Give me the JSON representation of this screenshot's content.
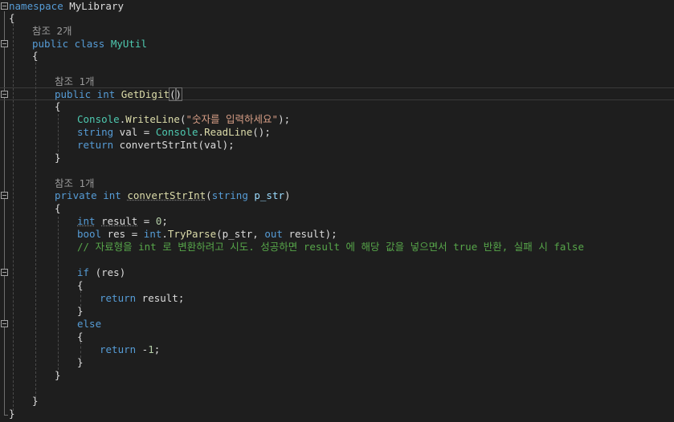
{
  "editor": {
    "line1": {
      "kw": "namespace",
      "name": " MyLibrary"
    },
    "line2": {
      "brace": "{"
    },
    "line3": {
      "lens": "참조 2개"
    },
    "line4": {
      "kw1": "public",
      "kw2": " class ",
      "name": "MyUtil"
    },
    "line5": {
      "brace": "{"
    },
    "line6": {
      "lens": "참조 1개"
    },
    "line7": {
      "kw1": "public",
      "kw2": " int ",
      "name": "GetDigit",
      "open": "(",
      "close": ")"
    },
    "line8": {
      "brace": "{"
    },
    "line9": {
      "type": "Console",
      "dot": ".",
      "method": "WriteLine",
      "open": "(",
      "str": "\"숫자를 입력하세요\"",
      "end": ");"
    },
    "line10": {
      "kw": "string",
      "var": " val = ",
      "type": "Console",
      "dot": ".",
      "method": "ReadLine",
      "end": "();"
    },
    "line11": {
      "kw": "return",
      "call": " convertStrInt(val);"
    },
    "line12": {
      "brace": "}"
    },
    "line13": {
      "lens": "참조 1개"
    },
    "line14": {
      "kw1": "private",
      "kw2": " int ",
      "name": "convertStrInt",
      "open": "(",
      "kw3": "string",
      "param": " p_str",
      "end": ")"
    },
    "line15": {
      "brace": "{"
    },
    "line16": {
      "kw": "int",
      "sp": " ",
      "var": "result",
      "rest": " = ",
      "num": "0",
      "end": ";"
    },
    "line17": {
      "kw": "bool",
      "rest1": " res = ",
      "kw2": "int",
      "dot": ".",
      "method": "TryParse",
      "rest2": "(p_str, ",
      "kw3": "out",
      "rest3": " result);"
    },
    "line18": {
      "comment": "// 자료형을 int 로 변환하려고 시도. 성공하면 result 에 해당 값을 넣으면서 true 반환, 실패 시 false"
    },
    "line19": {
      "kw": "if",
      "rest": " (res)"
    },
    "line20": {
      "brace": "{"
    },
    "line21": {
      "kw": "return",
      "rest": " result;"
    },
    "line22": {
      "brace": "}"
    },
    "line23": {
      "kw": "else"
    },
    "line24": {
      "brace": "{"
    },
    "line25": {
      "kw": "return",
      "rest": " -",
      "num": "1",
      "end": ";"
    },
    "line26": {
      "brace": "}"
    },
    "line27": {
      "brace": "}"
    },
    "line28": {
      "brace": "}"
    },
    "line29": {
      "brace": "}"
    }
  },
  "colors": {
    "background": "#1e1e1e",
    "keyword": "#569cd6",
    "type": "#4ec9b0",
    "method": "#dcdcaa",
    "string": "#d69d85",
    "comment": "#57a64a",
    "codelens": "#999999",
    "text": "#dcdcdc"
  }
}
